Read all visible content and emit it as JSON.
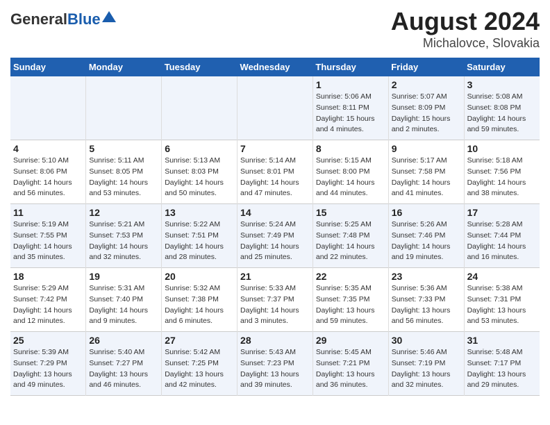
{
  "header": {
    "logo_general": "General",
    "logo_blue": "Blue",
    "title": "August 2024",
    "subtitle": "Michalovce, Slovakia"
  },
  "weekdays": [
    "Sunday",
    "Monday",
    "Tuesday",
    "Wednesday",
    "Thursday",
    "Friday",
    "Saturday"
  ],
  "weeks": [
    [
      {
        "day": "",
        "info": ""
      },
      {
        "day": "",
        "info": ""
      },
      {
        "day": "",
        "info": ""
      },
      {
        "day": "",
        "info": ""
      },
      {
        "day": "1",
        "info": "Sunrise: 5:06 AM\nSunset: 8:11 PM\nDaylight: 15 hours\nand 4 minutes."
      },
      {
        "day": "2",
        "info": "Sunrise: 5:07 AM\nSunset: 8:09 PM\nDaylight: 15 hours\nand 2 minutes."
      },
      {
        "day": "3",
        "info": "Sunrise: 5:08 AM\nSunset: 8:08 PM\nDaylight: 14 hours\nand 59 minutes."
      }
    ],
    [
      {
        "day": "4",
        "info": "Sunrise: 5:10 AM\nSunset: 8:06 PM\nDaylight: 14 hours\nand 56 minutes."
      },
      {
        "day": "5",
        "info": "Sunrise: 5:11 AM\nSunset: 8:05 PM\nDaylight: 14 hours\nand 53 minutes."
      },
      {
        "day": "6",
        "info": "Sunrise: 5:13 AM\nSunset: 8:03 PM\nDaylight: 14 hours\nand 50 minutes."
      },
      {
        "day": "7",
        "info": "Sunrise: 5:14 AM\nSunset: 8:01 PM\nDaylight: 14 hours\nand 47 minutes."
      },
      {
        "day": "8",
        "info": "Sunrise: 5:15 AM\nSunset: 8:00 PM\nDaylight: 14 hours\nand 44 minutes."
      },
      {
        "day": "9",
        "info": "Sunrise: 5:17 AM\nSunset: 7:58 PM\nDaylight: 14 hours\nand 41 minutes."
      },
      {
        "day": "10",
        "info": "Sunrise: 5:18 AM\nSunset: 7:56 PM\nDaylight: 14 hours\nand 38 minutes."
      }
    ],
    [
      {
        "day": "11",
        "info": "Sunrise: 5:19 AM\nSunset: 7:55 PM\nDaylight: 14 hours\nand 35 minutes."
      },
      {
        "day": "12",
        "info": "Sunrise: 5:21 AM\nSunset: 7:53 PM\nDaylight: 14 hours\nand 32 minutes."
      },
      {
        "day": "13",
        "info": "Sunrise: 5:22 AM\nSunset: 7:51 PM\nDaylight: 14 hours\nand 28 minutes."
      },
      {
        "day": "14",
        "info": "Sunrise: 5:24 AM\nSunset: 7:49 PM\nDaylight: 14 hours\nand 25 minutes."
      },
      {
        "day": "15",
        "info": "Sunrise: 5:25 AM\nSunset: 7:48 PM\nDaylight: 14 hours\nand 22 minutes."
      },
      {
        "day": "16",
        "info": "Sunrise: 5:26 AM\nSunset: 7:46 PM\nDaylight: 14 hours\nand 19 minutes."
      },
      {
        "day": "17",
        "info": "Sunrise: 5:28 AM\nSunset: 7:44 PM\nDaylight: 14 hours\nand 16 minutes."
      }
    ],
    [
      {
        "day": "18",
        "info": "Sunrise: 5:29 AM\nSunset: 7:42 PM\nDaylight: 14 hours\nand 12 minutes."
      },
      {
        "day": "19",
        "info": "Sunrise: 5:31 AM\nSunset: 7:40 PM\nDaylight: 14 hours\nand 9 minutes."
      },
      {
        "day": "20",
        "info": "Sunrise: 5:32 AM\nSunset: 7:38 PM\nDaylight: 14 hours\nand 6 minutes."
      },
      {
        "day": "21",
        "info": "Sunrise: 5:33 AM\nSunset: 7:37 PM\nDaylight: 14 hours\nand 3 minutes."
      },
      {
        "day": "22",
        "info": "Sunrise: 5:35 AM\nSunset: 7:35 PM\nDaylight: 13 hours\nand 59 minutes."
      },
      {
        "day": "23",
        "info": "Sunrise: 5:36 AM\nSunset: 7:33 PM\nDaylight: 13 hours\nand 56 minutes."
      },
      {
        "day": "24",
        "info": "Sunrise: 5:38 AM\nSunset: 7:31 PM\nDaylight: 13 hours\nand 53 minutes."
      }
    ],
    [
      {
        "day": "25",
        "info": "Sunrise: 5:39 AM\nSunset: 7:29 PM\nDaylight: 13 hours\nand 49 minutes."
      },
      {
        "day": "26",
        "info": "Sunrise: 5:40 AM\nSunset: 7:27 PM\nDaylight: 13 hours\nand 46 minutes."
      },
      {
        "day": "27",
        "info": "Sunrise: 5:42 AM\nSunset: 7:25 PM\nDaylight: 13 hours\nand 42 minutes."
      },
      {
        "day": "28",
        "info": "Sunrise: 5:43 AM\nSunset: 7:23 PM\nDaylight: 13 hours\nand 39 minutes."
      },
      {
        "day": "29",
        "info": "Sunrise: 5:45 AM\nSunset: 7:21 PM\nDaylight: 13 hours\nand 36 minutes."
      },
      {
        "day": "30",
        "info": "Sunrise: 5:46 AM\nSunset: 7:19 PM\nDaylight: 13 hours\nand 32 minutes."
      },
      {
        "day": "31",
        "info": "Sunrise: 5:48 AM\nSunset: 7:17 PM\nDaylight: 13 hours\nand 29 minutes."
      }
    ]
  ]
}
